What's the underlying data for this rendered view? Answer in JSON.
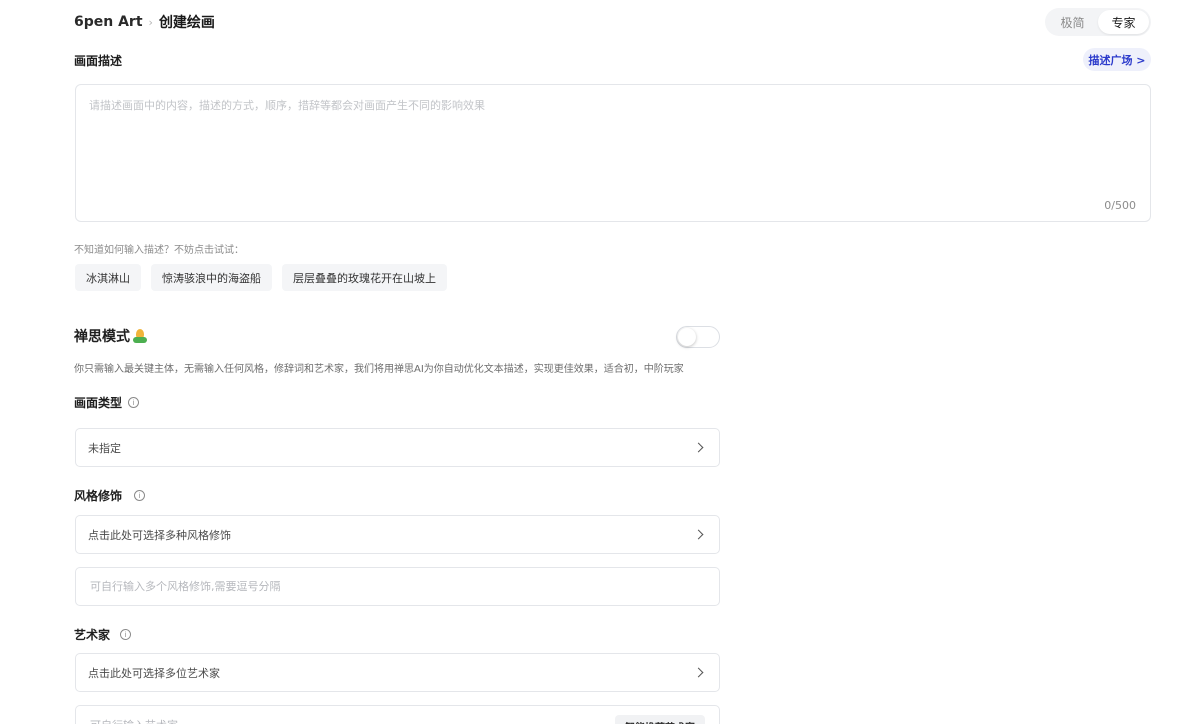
{
  "breadcrumb": {
    "root": "6pen Art",
    "separator": "›",
    "current": "创建绘画"
  },
  "mode_switch": {
    "options": [
      "极简",
      "专家"
    ],
    "selected": "专家"
  },
  "description": {
    "label": "画面描述",
    "plaza_link": "描述广场 >",
    "placeholder": "请描述画面中的内容，描述的方式，顺序，措辞等都会对画面产生不同的影响效果",
    "value": "",
    "counter": "0/500"
  },
  "suggestions": {
    "hint": "不知道如何输入描述？不妨点击试试：",
    "chips": [
      "冰淇淋山",
      "惊涛骇浪中的海盗船",
      "层层叠叠的玫瑰花开在山坡上"
    ]
  },
  "zen_mode": {
    "title": "禅思模式",
    "icon": "lotus-icon",
    "enabled": false,
    "description": "你只需输入最关键主体，无需输入任何风格，修辞词和艺术家，我们将用禅思AI为你自动优化文本描述，实现更佳效果，适合初，中阶玩家"
  },
  "picture_type": {
    "label": "画面类型",
    "value": "未指定"
  },
  "style": {
    "label": "风格修饰",
    "select_placeholder": "点击此处可选择多种风格修饰",
    "input_placeholder": "可自行输入多个风格修饰,需要逗号分隔"
  },
  "artist": {
    "label": "艺术家",
    "select_placeholder": "点击此处可选择多位艺术家",
    "input_placeholder": "可自行输入艺术家",
    "smart_button": "智能推荐艺术家"
  }
}
